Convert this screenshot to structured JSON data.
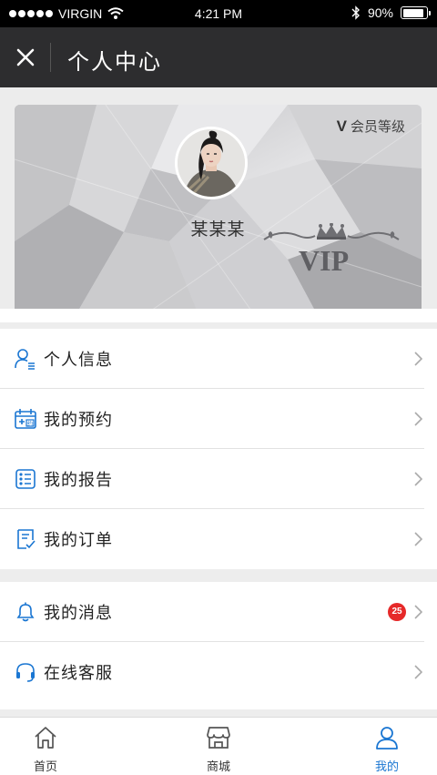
{
  "status_bar": {
    "carrier": "VIRGIN",
    "time": "4:21 PM",
    "battery": "90%",
    "battery_level": 0.9
  },
  "nav": {
    "title": "个人中心",
    "close_icon": "close-icon"
  },
  "vip_card": {
    "level_badge": "V",
    "level_label": "会员等级",
    "username": "某某某",
    "logo_text": "VIP"
  },
  "menu_groups": [
    {
      "items": [
        {
          "label": "个人信息",
          "icon": "user-profile-icon"
        },
        {
          "label": "我的预约",
          "icon": "calendar-icon"
        },
        {
          "label": "我的报告",
          "icon": "report-icon"
        },
        {
          "label": "我的订单",
          "icon": "order-icon"
        }
      ]
    },
    {
      "items": [
        {
          "label": "我的消息",
          "icon": "bell-icon",
          "badge": "25"
        },
        {
          "label": "在线客服",
          "icon": "headset-icon"
        }
      ]
    }
  ],
  "tabbar": {
    "tabs": [
      {
        "label": "首页",
        "icon": "home-icon",
        "active": false
      },
      {
        "label": "商城",
        "icon": "store-icon",
        "active": false
      },
      {
        "label": "我的",
        "icon": "user-icon",
        "active": true
      }
    ]
  },
  "colors": {
    "accent": "#1a76d2",
    "badge": "#e62929",
    "nav_bg": "#2d2d2f"
  }
}
